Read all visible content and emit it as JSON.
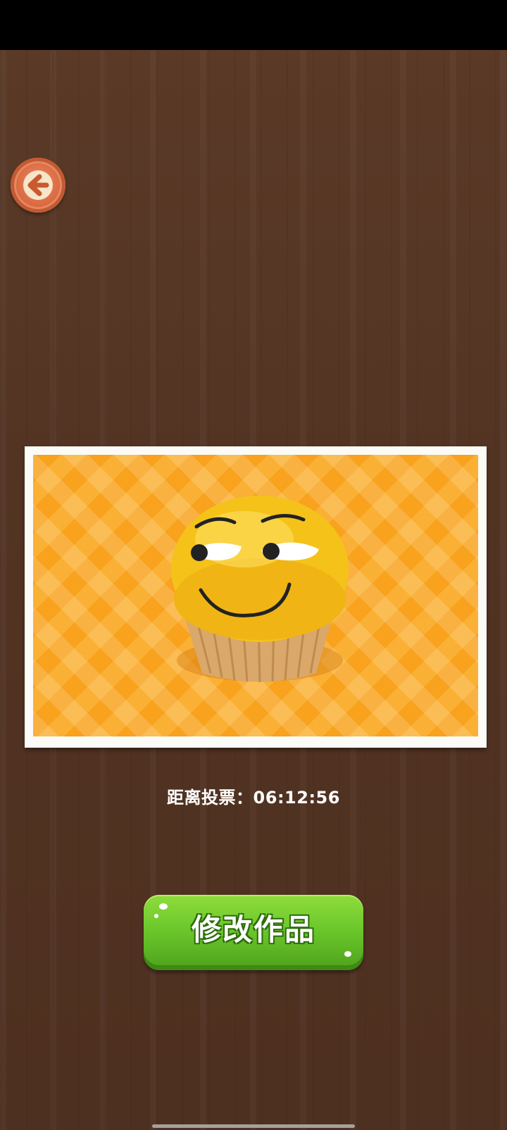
{
  "countdown": {
    "label": "距离投票：",
    "time": "06:12:56"
  },
  "actions": {
    "edit_label": "修改作品"
  },
  "icons": {
    "back": "arrow-left-icon"
  },
  "artwork": {
    "subject": "smiling cupcake emoji"
  },
  "colors": {
    "wood": "#5b3a27",
    "button_green": "#6cc82c",
    "back_button": "#d8683f",
    "artwork_background": "#f8a21e"
  }
}
